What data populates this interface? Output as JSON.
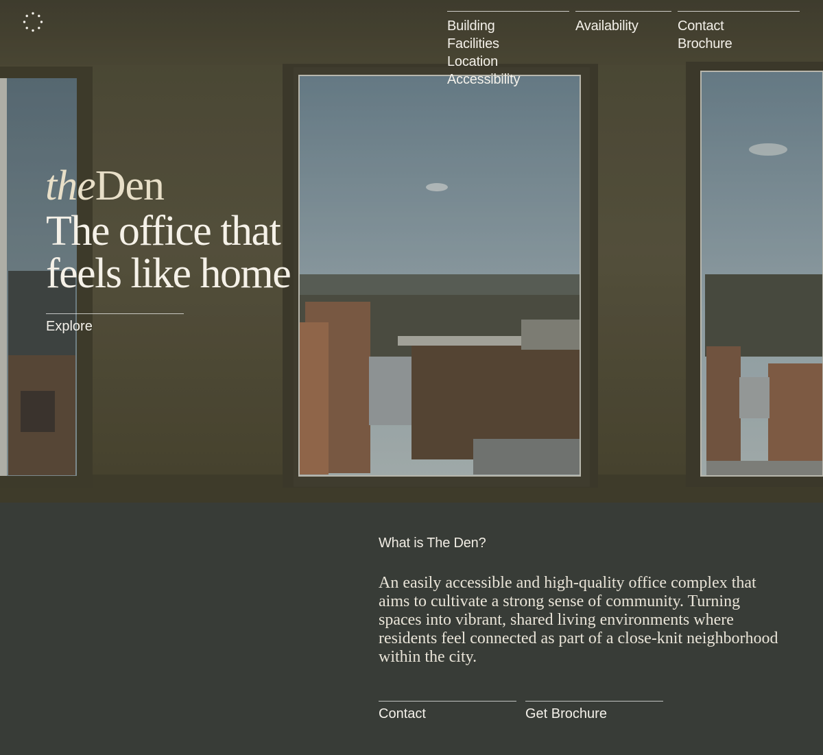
{
  "nav": {
    "col1": [
      "Building",
      "Facilities",
      "Location",
      "Accessibility"
    ],
    "col2": [
      "Availability"
    ],
    "col3": [
      "Contact",
      "Brochure"
    ]
  },
  "hero": {
    "brand_prefix": "the",
    "brand_name": "Den",
    "headline_line1": "The office that",
    "headline_line2": "feels like home",
    "explore_label": "Explore"
  },
  "about": {
    "heading": "What is The Den?",
    "body": "An easily accessible and high-quality office complex that aims to cultivate a strong sense of community. Turning spaces into vibrant, shared living environments where residents feel connected as part of a close-knit neighborhood within the city.",
    "cta_contact": "Contact",
    "cta_brochure": "Get Brochure"
  },
  "colors": {
    "hero_wall": "#4d4a37",
    "section_bg": "#383c37",
    "text_light": "#f4f1ea",
    "brand_cream": "#e8dfc8"
  },
  "icons": {
    "logo": "dotted-circle-logo-icon"
  }
}
